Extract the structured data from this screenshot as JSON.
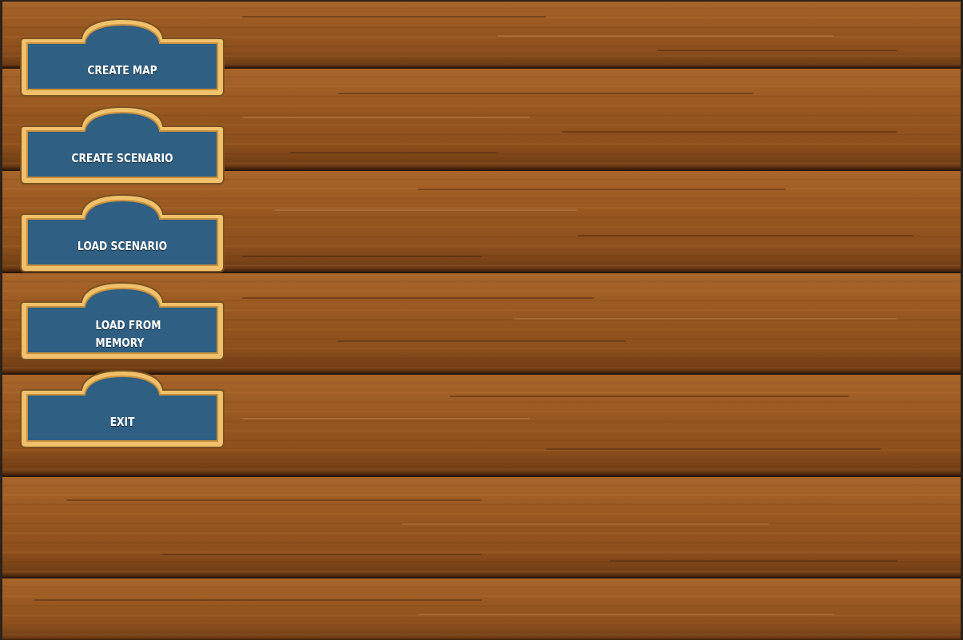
{
  "screen": {
    "name": "main-menu"
  },
  "menu": {
    "items": [
      {
        "label": "CREATE MAP"
      },
      {
        "label": "CREATE SCENARIO"
      },
      {
        "label": "LOAD SCENARIO"
      },
      {
        "label": "LOAD FROM\nMEMORY"
      },
      {
        "label": "EXIT"
      }
    ]
  },
  "colors": {
    "button_fill": "#2f5f82",
    "button_border": "#e6b35a",
    "wood": "#96561f",
    "text": "#ffffff"
  }
}
